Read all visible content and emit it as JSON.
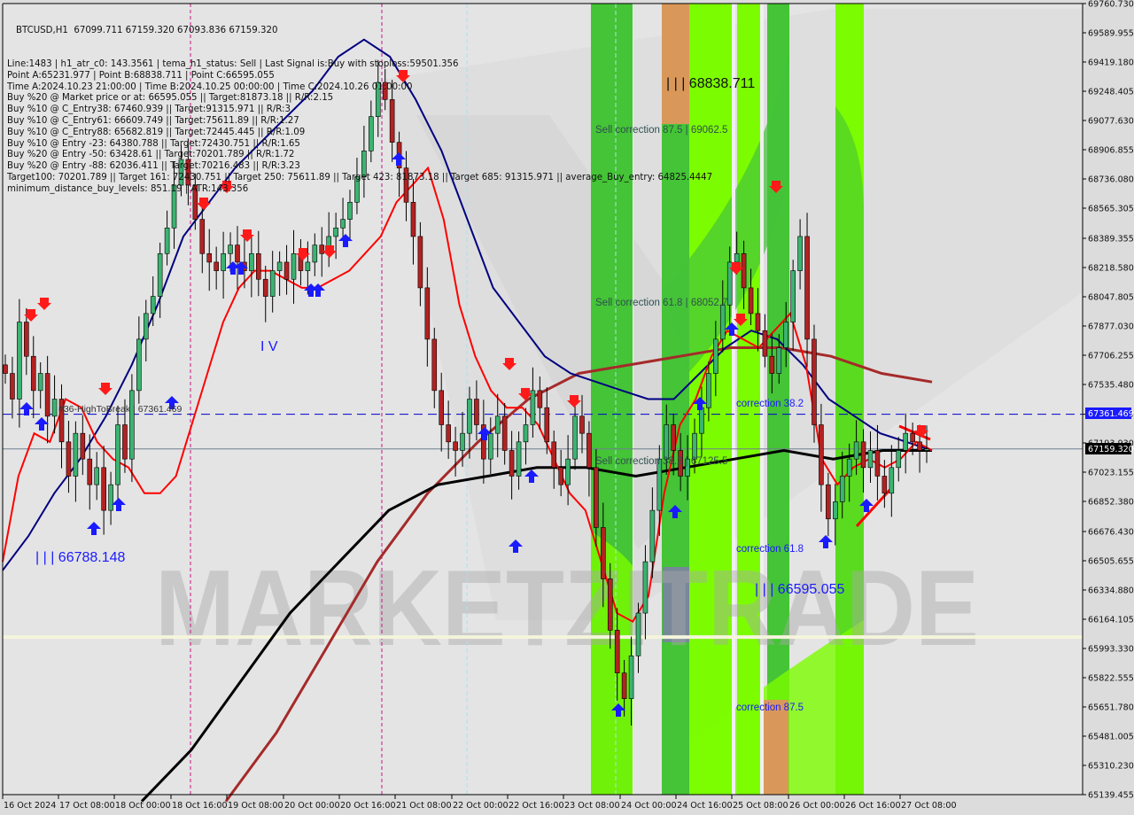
{
  "header": {
    "title_line": "BTCUSD,H1  67099.711 67159.320 67093.836 67159.320",
    "info_lines": [
      "Line:1483 | h1_atr_c0: 143.3561 | tema_h1_status: Sell | Last Signal is:Buy with stoploss:59501.356",
      "Point A:65231.977 | Point B:68838.711 | Point C:66595.055",
      "Time A:2024.10.23 21:00:00 | Time B:2024.10.25 00:00:00 | Time C:2024.10.26 01:00:00",
      "Buy %20 @ Market price or at: 66595.055 || Target:81873.18 || R/R:2.15",
      "Buy %10 @ C_Entry38: 67460.939 || Target:91315.971 || R/R:3",
      "Buy %10 @ C_Entry61: 66609.749 || Target:75611.89 || R/R:1.27",
      "Buy %10 @ C_Entry88: 65682.819 || Target:72445.445 || R/R:1.09",
      "Buy %10 @ Entry -23: 64380.788 || Target:72430.751 || R/R:1.65",
      "Buy %20 @ Entry -50: 63428.61 || Target:70201.789 || R/R:1.72",
      "Buy %20 @ Entry -88: 62036.411 || Target:70216.483 || R/R:3.23",
      "Target100: 70201.789 || Target 161: 72430.751 || Target 250: 75611.89 || Target 423: 81873.18 || Target 685: 91315.971 || average_Buy_entry: 64825.4447",
      "minimum_distance_buy_levels: 851.19 | ATR:143.356"
    ]
  },
  "annotations": {
    "point_b": "| | | 68838.711",
    "point_a_label": "| | | 66788.148",
    "point_c": "| | | 66595.055",
    "wave_iv": "I V",
    "sell_corr_875": "Sell correction 87.5 | 69062.5",
    "sell_corr_618": "Sell correction 61.8 | 68052.7",
    "sell_corr_382": "Sell correction 38.2 | 67125.5",
    "corr_382": "correction 38.2",
    "corr_618": "correction 61.8",
    "corr_875": "correction 87.5",
    "high_to_break": "#36-HighToBreak | 67361.469",
    "watermark": "MARKETZITRADE"
  },
  "price_tags": {
    "high_to_break": "67361.469",
    "current": "67159.320",
    "hidden_tick": "67193.930"
  },
  "colors": {
    "background": "#dcdcdc",
    "bull": "#3cb371",
    "bear": "#b22222",
    "ema_fast": "#ff0000",
    "ema_mid": "#000080",
    "ema_slow_black": "#000000",
    "ema_slow_brown": "#a52a2a",
    "green_zone": "#44c436",
    "lime_zone": "#7cfc00",
    "orange_zone": "#d9985a",
    "htb_line": "#0000cc",
    "current_line": "#708090"
  },
  "chart_data": {
    "type": "candlestick",
    "symbol": "BTCUSD",
    "timeframe": "H1",
    "ylim": [
      65139.455,
      69760.73
    ],
    "y_ticks": [
      "69760.730",
      "69589.955",
      "69419.180",
      "69248.405",
      "69077.630",
      "68906.855",
      "68736.080",
      "68565.305",
      "68389.355",
      "68218.580",
      "68047.805",
      "67877.030",
      "67706.255",
      "67535.480",
      "67361.469",
      "67193.930",
      "67023.155",
      "66852.380",
      "66676.430",
      "66505.655",
      "66334.880",
      "66164.105",
      "65993.330",
      "65822.555",
      "65651.780",
      "65481.005",
      "65310.230",
      "65139.455"
    ],
    "x_ticks": [
      "16 Oct 2024",
      "17 Oct 08:00",
      "18 Oct 00:00",
      "18 Oct 16:00",
      "19 Oct 08:00",
      "20 Oct 00:00",
      "20 Oct 16:00",
      "21 Oct 08:00",
      "22 Oct 00:00",
      "22 Oct 16:00",
      "23 Oct 08:00",
      "24 Oct 00:00",
      "24 Oct 16:00",
      "25 Oct 08:00",
      "26 Oct 00:00",
      "26 Oct 16:00",
      "27 Oct 08:00"
    ],
    "horizontal_levels": [
      {
        "name": "HighToBreak",
        "value": 67361.469,
        "style": "dashed"
      },
      {
        "name": "Current",
        "value": 67159.32,
        "style": "solid"
      },
      {
        "name": "Support",
        "value": 66060,
        "style": "solid-cream"
      }
    ],
    "close_path": [
      67600,
      67450,
      67900,
      67700,
      67500,
      67600,
      67350,
      67450,
      67200,
      67000,
      67250,
      67100,
      66950,
      67050,
      66800,
      66950,
      67300,
      67100,
      67500,
      67800,
      67950,
      68050,
      68300,
      68450,
      68700,
      68850,
      68700,
      68500,
      68300,
      68250,
      68200,
      68300,
      68350,
      68250,
      68200,
      68300,
      68150,
      68050,
      68200,
      68250,
      68150,
      68300,
      68200,
      68250,
      68350,
      68300,
      68400,
      68450,
      68500,
      68600,
      68750,
      68900,
      69100,
      69300,
      69200,
      68950,
      68800,
      68600,
      68400,
      68100,
      67800,
      67500,
      67300,
      67200,
      67150,
      67250,
      67450,
      67300,
      67100,
      67250,
      67350,
      67150,
      67000,
      67200,
      67300,
      67500,
      67400,
      67200,
      67050,
      66950,
      67100,
      67350,
      67250,
      67050,
      66700,
      66400,
      66100,
      65850,
      65700,
      65950,
      66200,
      66500,
      66800,
      67100,
      67300,
      67150,
      67000,
      67100,
      67250,
      67400,
      67600,
      67800,
      68000,
      68250,
      68300,
      68100,
      67950,
      67850,
      67700,
      67600,
      67750,
      67900,
      68200,
      68400,
      67800,
      67300,
      66950,
      66750,
      66850,
      67000,
      67100,
      67200,
      67050,
      67150,
      67000,
      66900,
      67050,
      67150,
      67250,
      67200,
      67150,
      67159.32
    ],
    "ema_fast_path": [
      66500,
      67000,
      67250,
      67200,
      67450,
      67400,
      67200,
      67100,
      67050,
      66900,
      66900,
      67000,
      67300,
      67600,
      67900,
      68100,
      68200,
      68200,
      68150,
      68100,
      68100,
      68150,
      68200,
      68300,
      68400,
      68600,
      68700,
      68800,
      68500,
      68000,
      67700,
      67500,
      67400,
      67400,
      67300,
      67100,
      66900,
      66800,
      66500,
      66200,
      66150,
      66300,
      66900,
      67300,
      67450,
      67700,
      67850,
      67800,
      67750,
      67850,
      67950,
      67650,
      67100,
      66950,
      67050,
      67100,
      67050,
      67100,
      67200,
      67150
    ],
    "ema_mid_path": [
      66450,
      66650,
      66900,
      67100,
      67350,
      67650,
      68000,
      68400,
      68600,
      68800,
      68950,
      69100,
      69250,
      69450,
      69550,
      69450,
      69200,
      68900,
      68500,
      68100,
      67900,
      67700,
      67600,
      67550,
      67500,
      67450,
      67450,
      67600,
      67750,
      67850,
      67800,
      67650,
      67450,
      67350,
      67250,
      67200,
      67150
    ],
    "ema_slow_black_path": [
      65100,
      65400,
      65800,
      66200,
      66500,
      66800,
      66950,
      67000,
      67050,
      67050,
      67000,
      67050,
      67100,
      67150,
      67100,
      67150,
      67150
    ],
    "ema_slow_brown_path": [
      65100,
      65500,
      66000,
      66500,
      66900,
      67200,
      67450,
      67600,
      67650,
      67700,
      67750,
      67750,
      67700,
      67600,
      67550
    ]
  }
}
